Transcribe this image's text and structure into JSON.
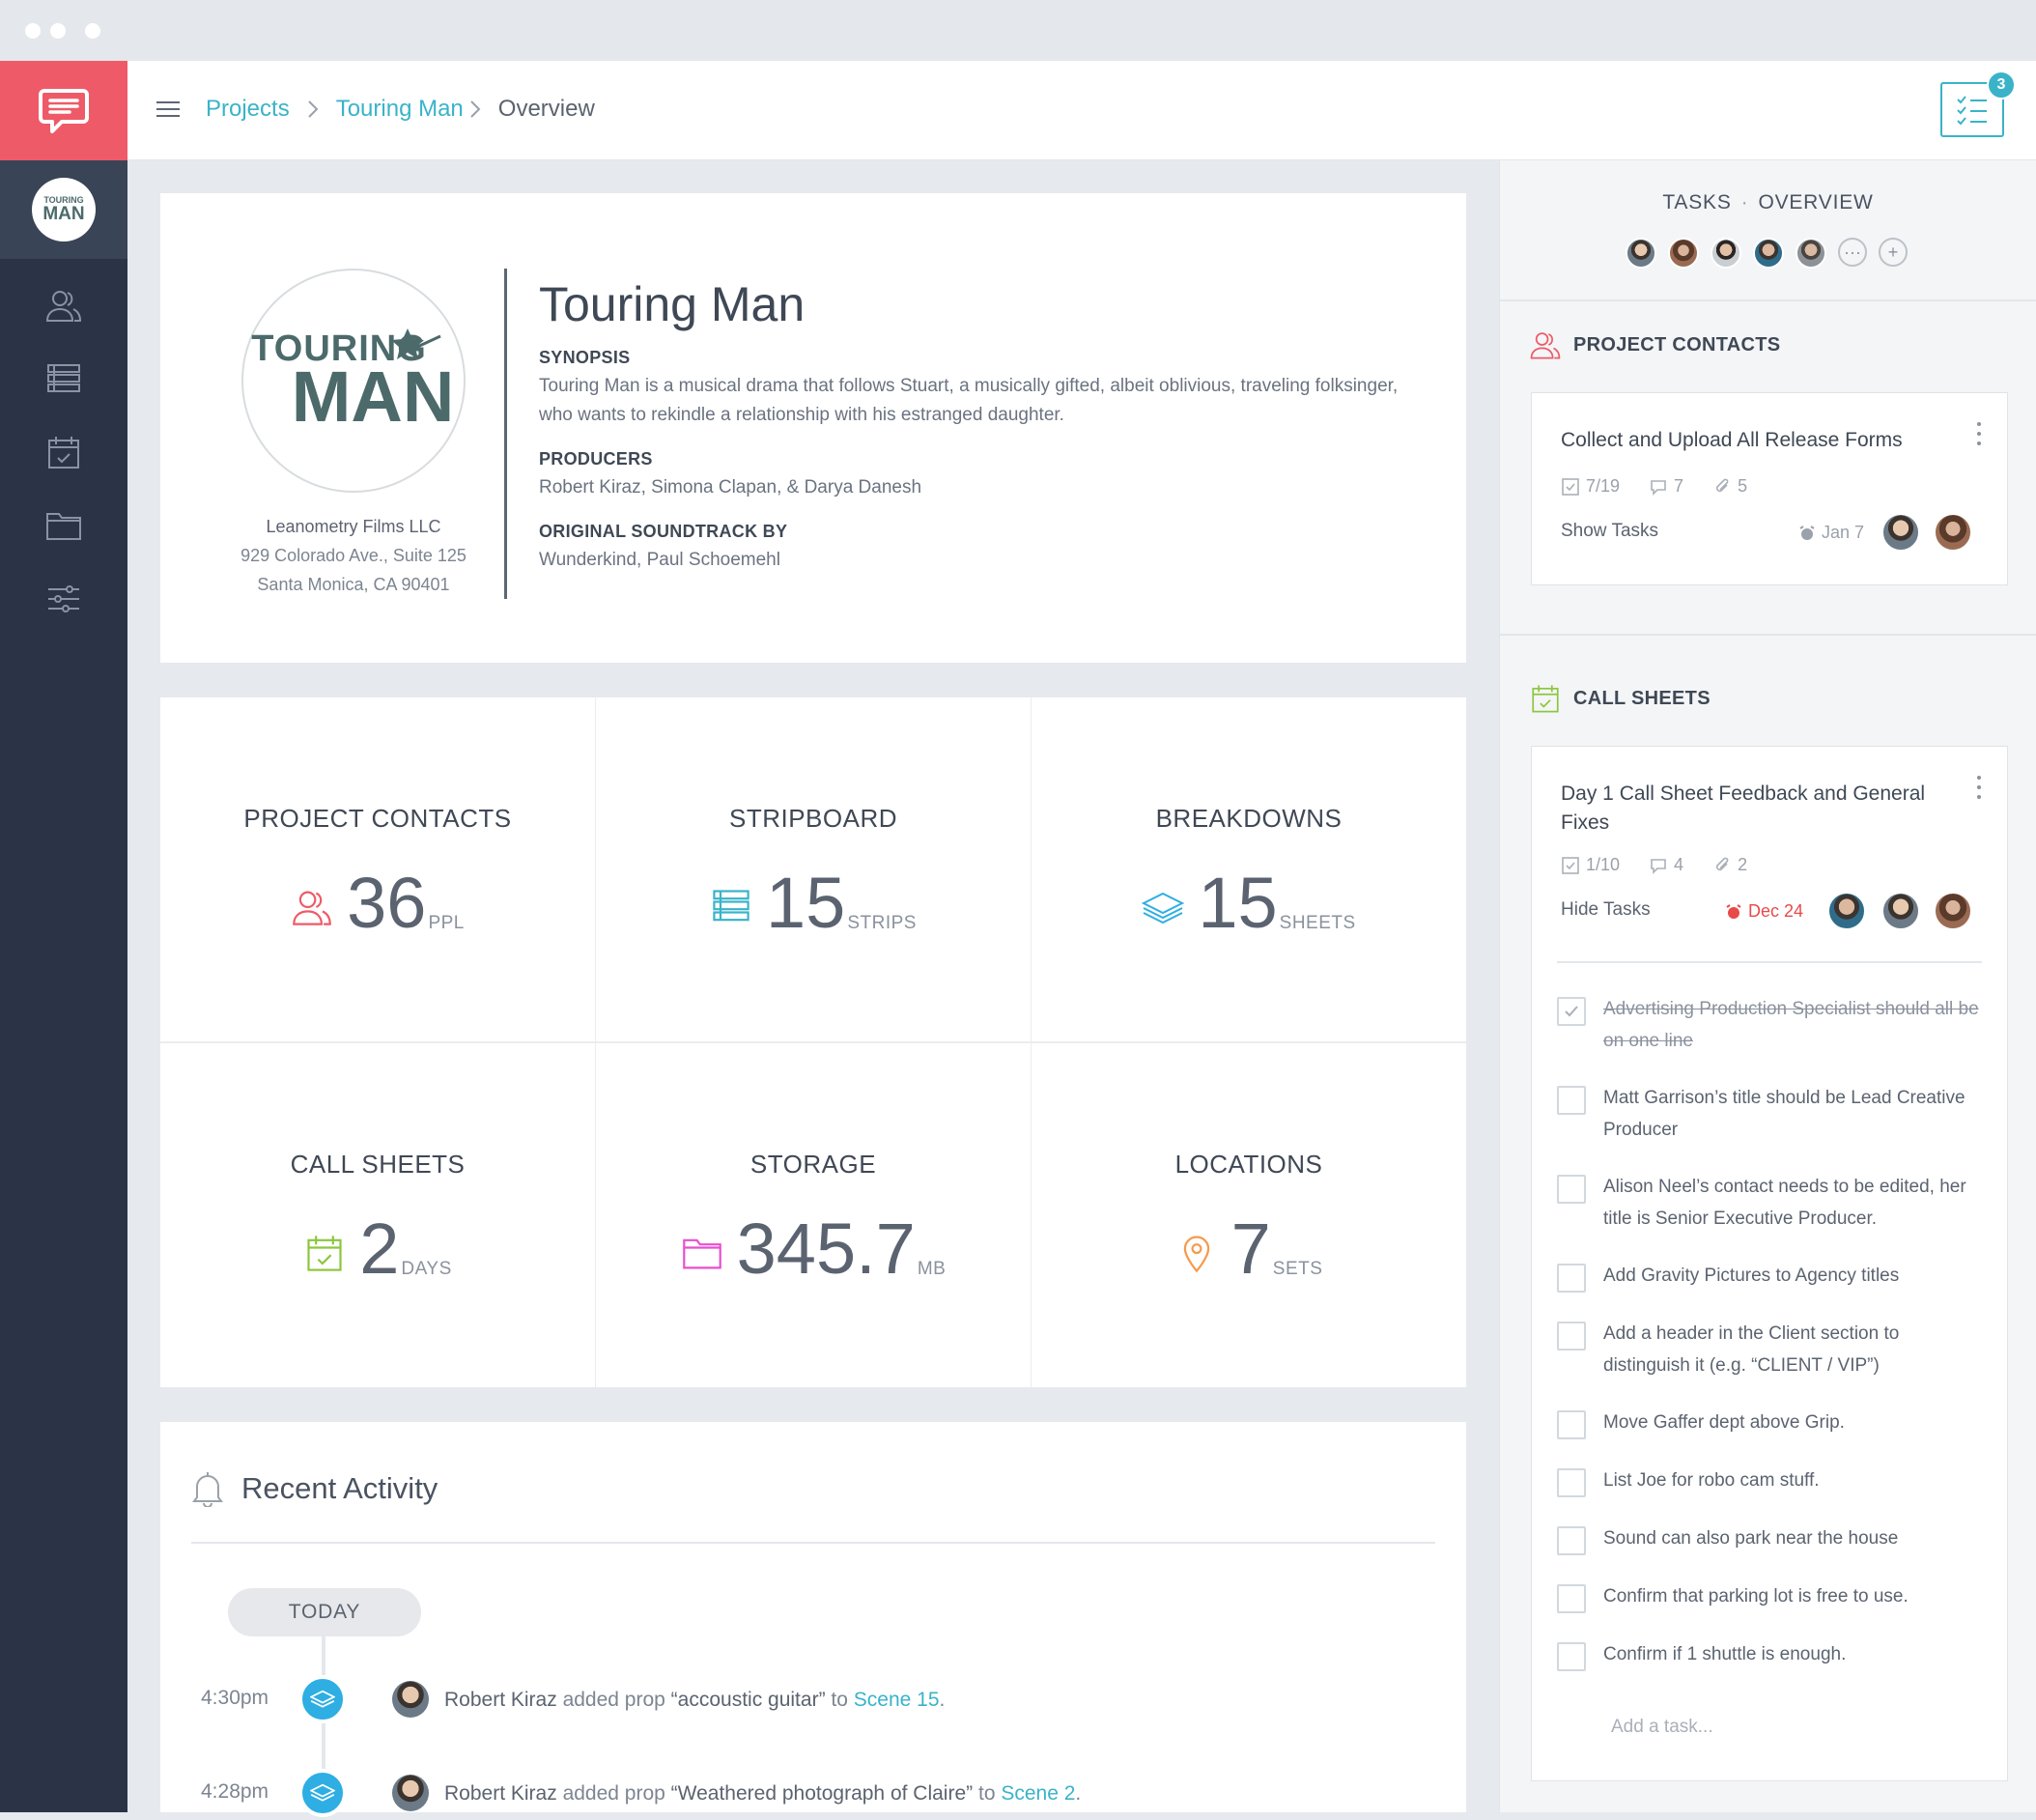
{
  "header": {
    "breadcrumb": [
      "Projects",
      "Touring Man",
      "Overview"
    ],
    "tasks_badge": "3"
  },
  "sidebar": {
    "project_avatar": {
      "line1": "TOURING",
      "line2": "MAN"
    },
    "items": [
      "contacts-icon",
      "stripboard-icon",
      "calendar-icon",
      "folder-icon",
      "settings-sliders-icon"
    ]
  },
  "project": {
    "title": "Touring Man",
    "logo": {
      "line1": "TOURING",
      "line2": "MAN"
    },
    "company": "Leanometry Films LLC",
    "address1": "929 Colorado Ave., Suite 125",
    "address2": "Santa Monica, CA 90401",
    "synopsis_label": "SYNOPSIS",
    "synopsis": "Touring Man is a musical drama that follows Stuart, a musically gifted, albeit oblivious, traveling folksinger, who wants to rekindle a relationship with his estranged daughter.",
    "producers_label": "PRODUCERS",
    "producers": "Robert Kiraz, Simona Clapan, & Darya Danesh",
    "soundtrack_label": "ORIGINAL SOUNDTRACK BY",
    "soundtrack": "Wunderkind, Paul Schoemehl"
  },
  "stats": [
    {
      "title": "PROJECT CONTACTS",
      "value": "36",
      "unit": "PPL",
      "icon": "contacts-icon",
      "color": "#ee5a67"
    },
    {
      "title": "STRIPBOARD",
      "value": "15",
      "unit": "STRIPS",
      "icon": "stripboard-icon",
      "color": "#3ab3c9"
    },
    {
      "title": "BREAKDOWNS",
      "value": "15",
      "unit": "SHEETS",
      "icon": "layers-icon",
      "color": "#2eaee3"
    },
    {
      "title": "CALL SHEETS",
      "value": "2",
      "unit": "DAYS",
      "icon": "calendar-icon",
      "color": "#8cc63f"
    },
    {
      "title": "STORAGE",
      "value": "345.7",
      "unit": "MB",
      "icon": "folder-icon",
      "color": "#e84fd0"
    },
    {
      "title": "LOCATIONS",
      "value": "7",
      "unit": "SETS",
      "icon": "location-pin-icon",
      "color": "#f59a4a"
    }
  ],
  "activity": {
    "title": "Recent Activity",
    "day_label": "TODAY",
    "items": [
      {
        "time": "4:30pm",
        "user": "Robert Kiraz",
        "action": "added prop",
        "object": "“accoustic guitar”",
        "joiner": "to",
        "target": "Scene 15",
        "end": "."
      },
      {
        "time": "4:28pm",
        "user": "Robert Kiraz",
        "action": "added prop",
        "object": "“Weathered photograph of Claire”",
        "joiner": "to",
        "target": "Scene 2",
        "end": "."
      }
    ]
  },
  "right_panel": {
    "tab_tasks": "TASKS",
    "tab_separator": "·",
    "tab_overview": "OVERVIEW",
    "avatar_more": "···",
    "avatar_add": "+",
    "contacts_section": {
      "title": "PROJECT CONTACTS",
      "card": {
        "title": "Collect and Upload All Release Forms",
        "checks": "7/19",
        "comments": "7",
        "attachments": "5",
        "toggle": "Show Tasks",
        "due": "Jan 7",
        "due_color": "#9aa1ab"
      }
    },
    "callsheets_section": {
      "title": "CALL SHEETS",
      "card": {
        "title": "Day 1 Call Sheet Feedback and General Fixes",
        "checks": "1/10",
        "comments": "4",
        "attachments": "2",
        "toggle": "Hide Tasks",
        "due": "Dec 24",
        "due_color": "#e84a4a",
        "tasks": [
          {
            "text": "Advertising Production Specialist should all be on one line",
            "done": true
          },
          {
            "text": "Matt Garrison’s title should be Lead Creative Producer",
            "done": false
          },
          {
            "text": "Alison Neel’s contact needs to be edited, her title is Senior Executive Producer.",
            "done": false
          },
          {
            "text": "Add Gravity Pictures to Agency titles",
            "done": false
          },
          {
            "text": "Add a header in the Client section to distinguish it (e.g. “CLIENT / VIP”)",
            "done": false
          },
          {
            "text": "Move Gaffer dept above Grip.",
            "done": false
          },
          {
            "text": "List Joe for robo cam stuff.",
            "done": false
          },
          {
            "text": "Sound can also park near the house",
            "done": false
          },
          {
            "text": "Confirm that parking lot is free to use.",
            "done": false
          },
          {
            "text": "Confirm if 1 shuttle is enough.",
            "done": false
          }
        ],
        "add_placeholder": "Add a task..."
      }
    }
  }
}
